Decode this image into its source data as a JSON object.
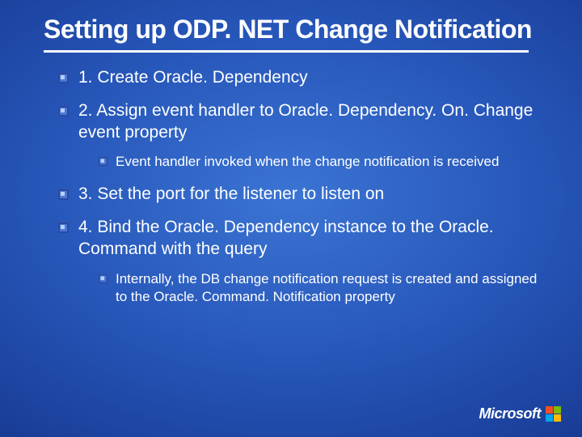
{
  "title": "Setting up ODP. NET Change Notification",
  "items": [
    {
      "text": "1. Create Oracle. Dependency"
    },
    {
      "text": "2. Assign event handler to Oracle. Dependency. On. Change event property",
      "sub": "Event handler invoked when the change notification is received"
    },
    {
      "text": "3. Set the port for the listener to listen on"
    },
    {
      "text": "4. Bind the Oracle. Dependency instance to the Oracle. Command with the query",
      "sub": "Internally, the DB change notification request is created and assigned to the Oracle. Command. Notification property"
    }
  ],
  "footer": {
    "brand": "Microsoft"
  }
}
